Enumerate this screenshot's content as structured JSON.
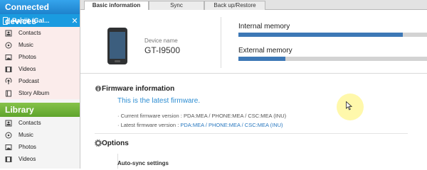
{
  "sidebar": {
    "connected_title": "Connected devices",
    "device_name": "Ranjit (Gal...",
    "close_glyph": "✕",
    "device_items": [
      {
        "label": "Contacts",
        "icon": "contacts-icon"
      },
      {
        "label": "Music",
        "icon": "music-icon"
      },
      {
        "label": "Photos",
        "icon": "photos-icon"
      },
      {
        "label": "Videos",
        "icon": "videos-icon"
      },
      {
        "label": "Podcast",
        "icon": "podcast-icon"
      },
      {
        "label": "Story Album",
        "icon": "story-album-icon"
      }
    ],
    "library_title": "Library",
    "library_items": [
      {
        "label": "Contacts",
        "icon": "contacts-icon"
      },
      {
        "label": "Music",
        "icon": "music-icon"
      },
      {
        "label": "Photos",
        "icon": "photos-icon"
      },
      {
        "label": "Videos",
        "icon": "videos-icon"
      }
    ]
  },
  "tabs": [
    {
      "label": "Basic information",
      "active": true
    },
    {
      "label": "Sync",
      "active": false
    },
    {
      "label": "Back up/Restore",
      "active": false
    }
  ],
  "device": {
    "name_label": "Device name",
    "model": "GT-I9500"
  },
  "memory": {
    "internal_label": "Internal memory",
    "internal_used_fraction": 0.87,
    "external_label": "External memory",
    "external_used_fraction": 0.25
  },
  "firmware": {
    "title": "Firmware information",
    "status": "This is the latest firmware.",
    "current_prefix": "· Current firmware version : ",
    "current_value": "PDA:MEA / PHONE:MEA / CSC:MEA (INU)",
    "latest_prefix": "· Latest firmware version : ",
    "latest_value": "PDA:MEA / PHONE:MEA / CSC:MEA (INU)"
  },
  "options": {
    "title": "Options",
    "autosync_label": "Auto-sync settings"
  },
  "colors": {
    "accent_blue": "#1a9be0",
    "library_green": "#6cae35",
    "memory_fill": "#3d78b6",
    "link_blue": "#2a79c0"
  }
}
